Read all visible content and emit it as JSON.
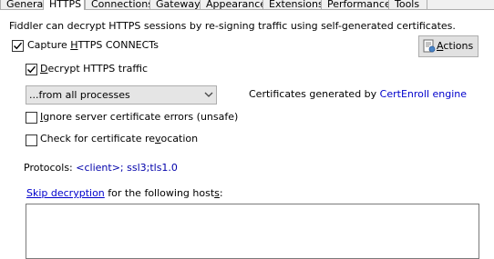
{
  "tabs": [
    {
      "label": "General"
    },
    {
      "label": "HTTPS"
    },
    {
      "label": "Connections"
    },
    {
      "label": "Gateway"
    },
    {
      "label": "Appearance"
    },
    {
      "label": "Extensions"
    },
    {
      "label": "Performance"
    },
    {
      "label": "Tools"
    }
  ],
  "active_tab": "HTTPS",
  "description": "Fiddler can decrypt HTTPS sessions by re-signing traffic using self-generated certificates.",
  "capture": {
    "label_pre": "Capture ",
    "label_u": "H",
    "label_post": "TTPS CONNECTs",
    "checked": true
  },
  "actions": {
    "label_u": "A",
    "label_post": "ctions",
    "icon": "certificate-icon"
  },
  "decrypt": {
    "label_pre": "",
    "label_u": "D",
    "label_post": "ecrypt HTTPS traffic",
    "checked": true
  },
  "process_select": {
    "value": "...from all processes"
  },
  "cert_info": {
    "text": "Certificates generated by ",
    "engine": "CertEnroll engine"
  },
  "ignore_errors": {
    "label_pre": "",
    "label_u": "I",
    "label_post": "gnore server certificate errors (unsafe)",
    "checked": false
  },
  "revocation": {
    "label_pre": "Check for certificate re",
    "label_u": "v",
    "label_post": "ocation",
    "checked": false
  },
  "protocols": {
    "label": "Protocols: ",
    "value": "<client>; ssl3;tls1.0"
  },
  "skip": {
    "link": "Skip decryption",
    "text_pre": " for the following host",
    "text_u": "s",
    "text_post": ":"
  },
  "skip_hosts_value": "",
  "colors": {
    "link": "#0000cc",
    "panel_bg": "#ffffff",
    "window_bg": "#f0f0f0"
  }
}
